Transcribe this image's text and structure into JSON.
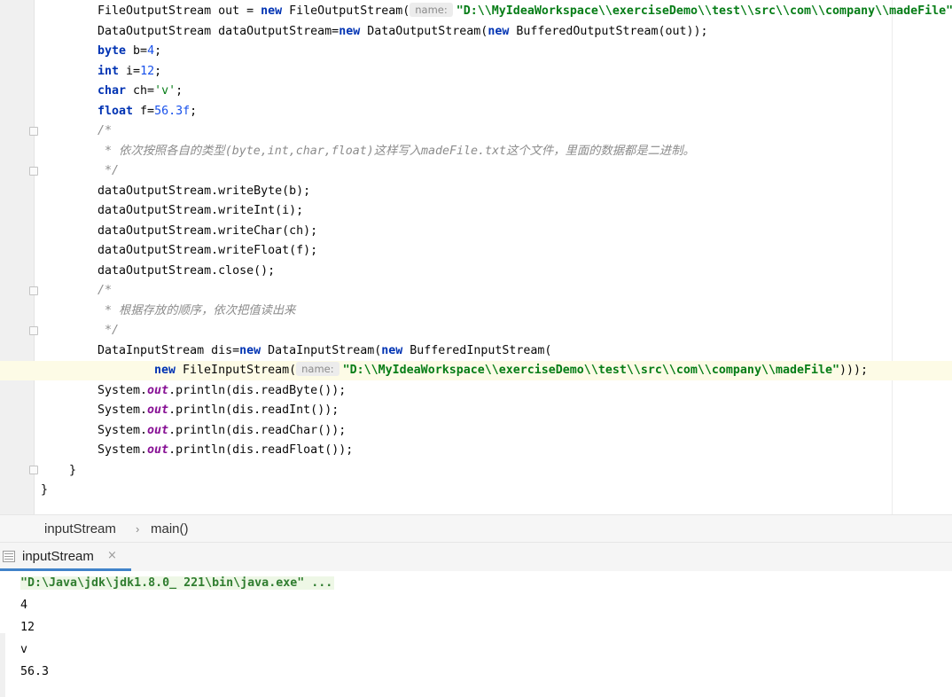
{
  "editor": {
    "hint_label": "name:",
    "lines": [
      {
        "indent": 110,
        "segs": [
          [
            "t",
            "FileOutputStream out = "
          ],
          [
            "kw",
            "new"
          ],
          [
            "t",
            " FileOutputStream("
          ],
          [
            "hint",
            "name:"
          ],
          [
            "str",
            "\"D:\\\\MyIdeaWorkspace\\\\exerciseDemo\\\\test\\\\src\\\\com\\\\company\\\\madeFile\""
          ]
        ]
      },
      {
        "indent": 110,
        "segs": [
          [
            "t",
            "DataOutputStream dataOutputStream="
          ],
          [
            "kw",
            "new"
          ],
          [
            "t",
            " DataOutputStream("
          ],
          [
            "kw",
            "new"
          ],
          [
            "t",
            " BufferedOutputStream(out));"
          ]
        ]
      },
      {
        "indent": 110,
        "segs": [
          [
            "kw",
            "byte"
          ],
          [
            "t",
            " b="
          ],
          [
            "num",
            "4"
          ],
          [
            "t",
            ";"
          ]
        ]
      },
      {
        "indent": 110,
        "segs": [
          [
            "kw",
            "int"
          ],
          [
            "t",
            " i="
          ],
          [
            "num",
            "12"
          ],
          [
            "t",
            ";"
          ]
        ]
      },
      {
        "indent": 110,
        "segs": [
          [
            "kw",
            "char"
          ],
          [
            "t",
            " ch="
          ],
          [
            "chr",
            "'v'"
          ],
          [
            "t",
            ";"
          ]
        ]
      },
      {
        "indent": 110,
        "segs": [
          [
            "kw",
            "float"
          ],
          [
            "t",
            " f="
          ],
          [
            "num",
            "56.3f"
          ],
          [
            "t",
            ";"
          ]
        ]
      },
      {
        "indent": 110,
        "segs": [
          [
            "cmt",
            "/*"
          ]
        ]
      },
      {
        "indent": 110,
        "segs": [
          [
            "cmt",
            " * 依次按照各自的类型(byte,int,char,float)这样写入madeFile.txt这个文件，里面的数据都是二进制。"
          ]
        ]
      },
      {
        "indent": 110,
        "segs": [
          [
            "cmt",
            " */"
          ]
        ]
      },
      {
        "indent": 110,
        "segs": [
          [
            "t",
            "dataOutputStream.writeByte(b);"
          ]
        ]
      },
      {
        "indent": 110,
        "segs": [
          [
            "t",
            "dataOutputStream.writeInt(i);"
          ]
        ]
      },
      {
        "indent": 110,
        "segs": [
          [
            "t",
            "dataOutputStream.writeChar(ch);"
          ]
        ]
      },
      {
        "indent": 110,
        "segs": [
          [
            "t",
            "dataOutputStream.writeFloat(f);"
          ]
        ]
      },
      {
        "indent": 110,
        "segs": [
          [
            "t",
            "dataOutputStream.close();"
          ]
        ]
      },
      {
        "indent": 110,
        "segs": [
          [
            "cmt",
            "/*"
          ]
        ]
      },
      {
        "indent": 110,
        "segs": [
          [
            "cmt",
            " * 根据存放的顺序，依次把值读出来"
          ]
        ]
      },
      {
        "indent": 110,
        "segs": [
          [
            "cmt",
            " */"
          ]
        ]
      },
      {
        "indent": 110,
        "segs": [
          [
            "t",
            "DataInputStream dis="
          ],
          [
            "kw",
            "new"
          ],
          [
            "t",
            " DataInputStream("
          ],
          [
            "kw",
            "new"
          ],
          [
            "t",
            " BufferedInputStream("
          ]
        ]
      },
      {
        "indent": 174,
        "segs": [
          [
            "kw",
            "new"
          ],
          [
            "t",
            " FileInputStream("
          ],
          [
            "hint",
            "name:"
          ],
          [
            "str",
            "\"D:\\\\MyIdeaWorkspace\\\\exerciseDemo\\\\test\\\\src\\\\com\\\\company\\\\madeFile\""
          ],
          [
            "t",
            ")));"
          ]
        ]
      },
      {
        "indent": 110,
        "segs": [
          [
            "t",
            "System."
          ],
          [
            "fld",
            "out"
          ],
          [
            "t",
            ".println(dis.readByte());"
          ]
        ]
      },
      {
        "indent": 110,
        "segs": [
          [
            "t",
            "System."
          ],
          [
            "fld",
            "out"
          ],
          [
            "t",
            ".println(dis.readInt());"
          ]
        ]
      },
      {
        "indent": 110,
        "segs": [
          [
            "t",
            "System."
          ],
          [
            "fld",
            "out"
          ],
          [
            "t",
            ".println(dis.readChar());"
          ]
        ]
      },
      {
        "indent": 110,
        "segs": [
          [
            "t",
            "System."
          ],
          [
            "fld",
            "out"
          ],
          [
            "t",
            ".println(dis.readFloat());"
          ]
        ]
      },
      {
        "indent": 78,
        "segs": [
          [
            "t",
            "}"
          ]
        ]
      },
      {
        "indent": 46,
        "segs": [
          [
            "t",
            "}"
          ]
        ]
      }
    ]
  },
  "breadcrumb": {
    "class_name": "inputStream",
    "separator": "›",
    "method_name": "main()"
  },
  "run_panel": {
    "tab_label": "inputStream",
    "tab_close": "×",
    "command": "\"D:\\Java\\jdk\\jdk1.8.0_ 221\\bin\\java.exe\" ...",
    "output": [
      "4",
      "12",
      "v",
      "56.3"
    ]
  }
}
